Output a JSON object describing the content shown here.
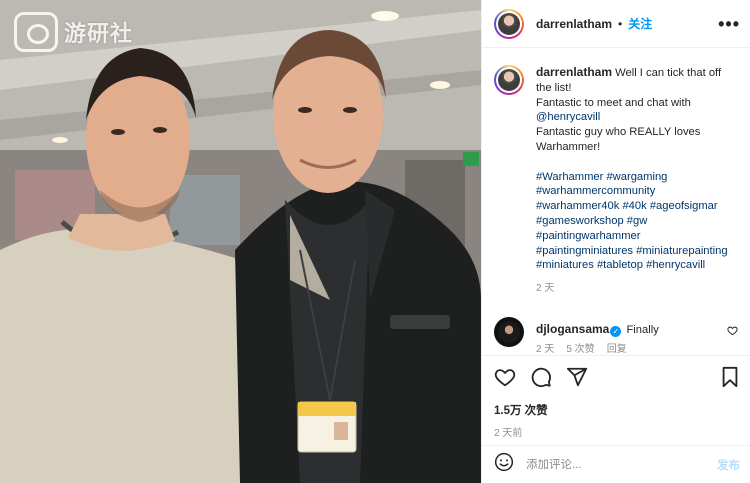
{
  "watermark": {
    "text": "游研社"
  },
  "header": {
    "username": "darrenlatham",
    "separator": "•",
    "follow_label": "关注",
    "more_label": "•••"
  },
  "caption": {
    "username": "darrenlatham",
    "line1": "Well I can tick that off the list!",
    "line2": "Fantastic to meet and chat with",
    "mention": "@henrycavill",
    "line3": "Fantastic guy who REALLY loves Warhammer!",
    "hashtags": [
      "#Warhammer",
      "#wargaming",
      "#warhammercommunity",
      "#warhammer40k",
      "#40k",
      "#ageofsigmar",
      "#gamesworkshop",
      "#gw",
      "#paintingwarhammer",
      "#paintingminiatures",
      "#miniaturepainting",
      "#miniatures",
      "#tabletop",
      "#henrycavill"
    ],
    "time": "2 天"
  },
  "comment": {
    "username": "djlogansama",
    "verified_mark": "✓",
    "text": "Finally",
    "meta_time": "2 天",
    "meta_likes": "5 次赞",
    "meta_reply": "回复"
  },
  "actions": {
    "icons": [
      "heart-icon",
      "comment-icon",
      "share-icon",
      "bookmark-icon"
    ],
    "likes": "1.5万 次赞",
    "time": "2 天前"
  },
  "add_comment": {
    "emoji_icon": "smiley-icon",
    "placeholder": "添加评论...",
    "post_label": "发布"
  },
  "colors": {
    "link": "#00376b",
    "accent": "#0095f6",
    "muted": "#8e8e8e",
    "text": "#262626"
  }
}
